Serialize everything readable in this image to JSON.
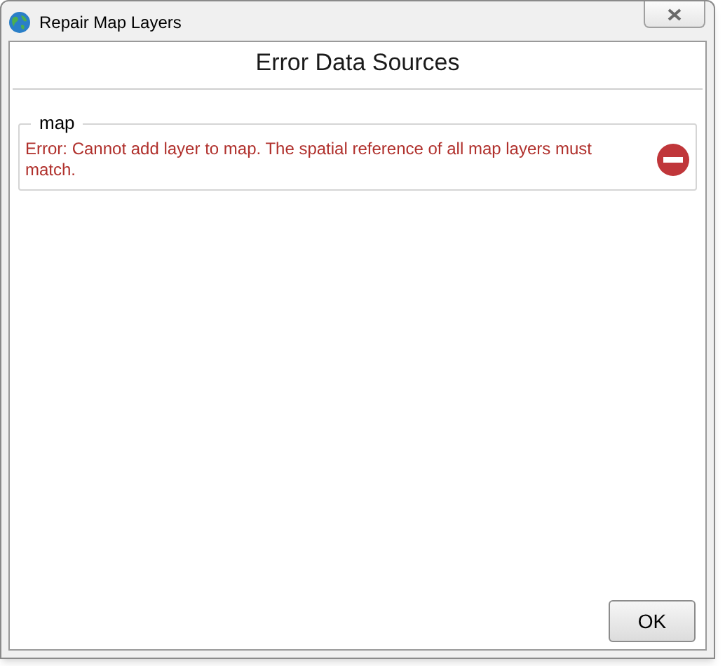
{
  "window": {
    "title": "Repair Map Layers"
  },
  "heading": "Error Data Sources",
  "groups": [
    {
      "name": "map",
      "errors": [
        {
          "message": "Error: Cannot add layer to map. The spatial reference of all map layers must match."
        }
      ]
    }
  ],
  "buttons": [
    "OK"
  ]
}
